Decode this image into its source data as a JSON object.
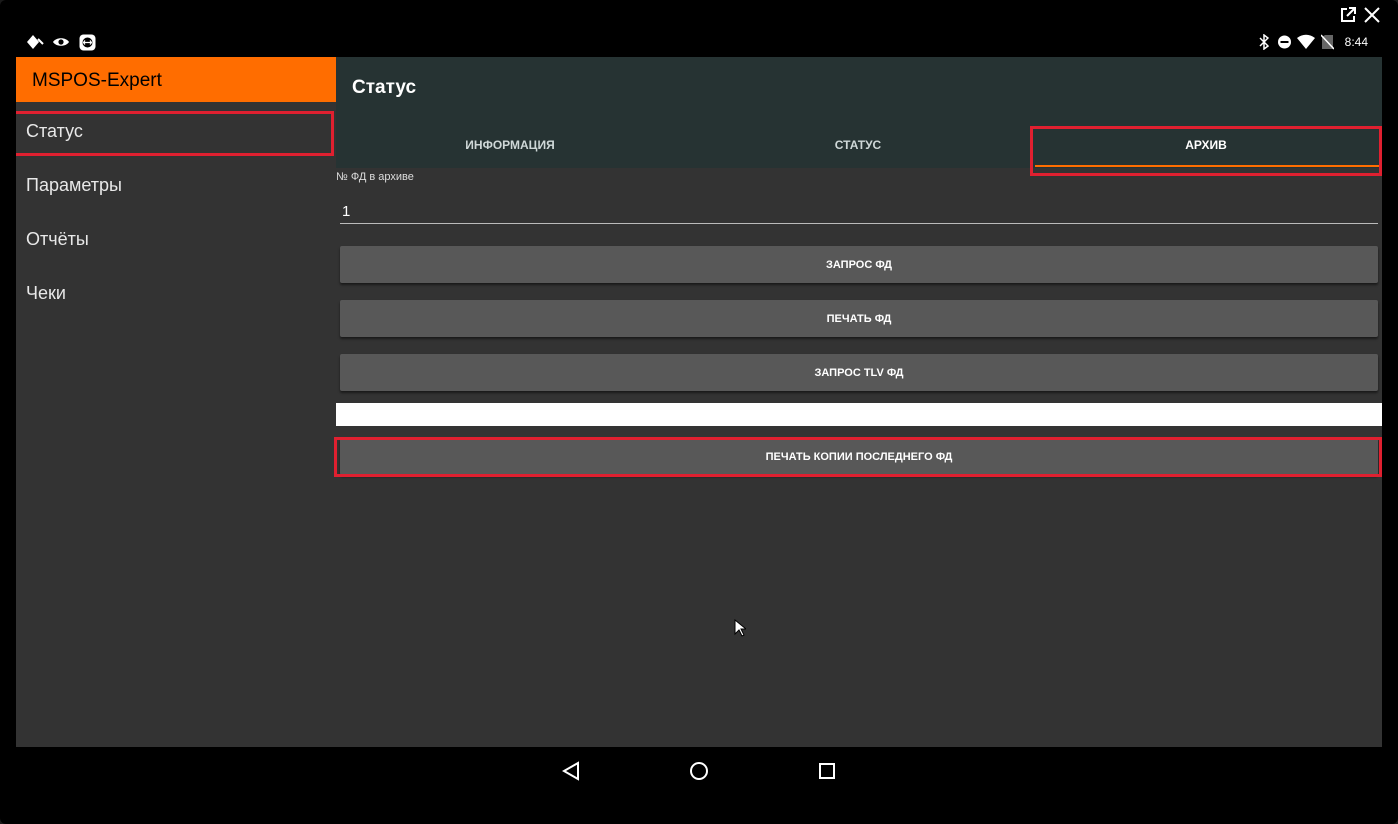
{
  "window": {
    "popout_icon": "popout-icon",
    "close_icon": "close-icon"
  },
  "statusbar": {
    "left_icons": [
      "diamond-icon",
      "eye-icon",
      "teamviewer-icon"
    ],
    "right_icons": [
      "bluetooth-icon",
      "dnd-icon",
      "wifi-icon",
      "no-sim-icon"
    ],
    "time": "8:44"
  },
  "sidebar": {
    "app_name": "MSPOS-Expert",
    "items": [
      {
        "label": "Статус"
      },
      {
        "label": "Параметры"
      },
      {
        "label": "Отчёты"
      },
      {
        "label": "Чеки"
      }
    ]
  },
  "main": {
    "title": "Статус",
    "tabs": [
      {
        "label": "ИНФОРМАЦИЯ"
      },
      {
        "label": "СТАТУС"
      },
      {
        "label": "АРХИВ"
      }
    ],
    "active_tab": "АРХИВ",
    "field": {
      "label": "№ ФД в архиве",
      "value": "1"
    },
    "buttons": {
      "request_fd": "ЗАПРОС ФД",
      "print_fd": "ПЕЧАТЬ ФД",
      "request_tlv": "ЗАПРОС TLV ФД",
      "print_last_copy": "ПЕЧАТЬ КОПИИ ПОСЛЕДНЕГО ФД"
    }
  },
  "colors": {
    "accent": "#ff6d00",
    "highlight": "#e02030",
    "appbar": "#263333",
    "background": "#333333"
  }
}
